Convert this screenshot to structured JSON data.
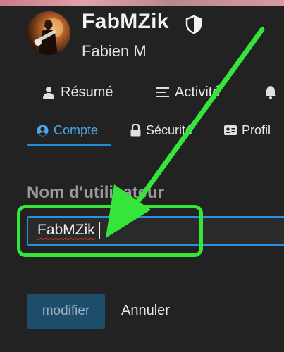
{
  "profile": {
    "username": "FabMZik",
    "full_name": "Fabien M"
  },
  "primary_nav": {
    "summary_label": "Résumé",
    "activity_label": "Activité"
  },
  "tabs": {
    "account_label": "Compte",
    "security_label": "Sécurité",
    "profile_label": "Profil"
  },
  "form": {
    "username_label": "Nom d'utilisateur",
    "username_value": "FabMZik",
    "submit_label": "modifier",
    "cancel_label": "Annuler"
  },
  "icons": {
    "badge": "shield-half-icon",
    "summary": "user-icon",
    "activity": "list-icon",
    "notifications": "bell-icon",
    "account": "user-circle-icon",
    "security": "lock-icon",
    "profile": "id-card-icon"
  },
  "colors": {
    "background": "#222222",
    "accent": "#1e8ed8",
    "annotation": "#35e53a",
    "button_bg": "#1d4d6a"
  }
}
